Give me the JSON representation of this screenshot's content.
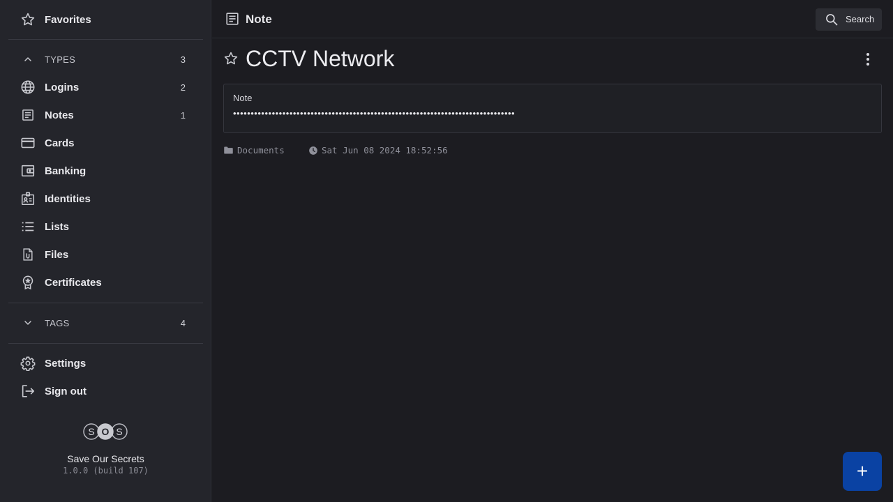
{
  "sidebar": {
    "favorites_label": "Favorites",
    "types": {
      "label": "TYPES",
      "count": "3"
    },
    "items": [
      {
        "label": "Logins",
        "count": "2",
        "icon": "globe-icon"
      },
      {
        "label": "Notes",
        "count": "1",
        "icon": "note-icon"
      },
      {
        "label": "Cards",
        "count": "",
        "icon": "card-icon"
      },
      {
        "label": "Banking",
        "count": "",
        "icon": "wallet-icon"
      },
      {
        "label": "Identities",
        "count": "",
        "icon": "id-badge-icon"
      },
      {
        "label": "Lists",
        "count": "",
        "icon": "list-icon"
      },
      {
        "label": "Files",
        "count": "",
        "icon": "file-clip-icon"
      },
      {
        "label": "Certificates",
        "count": "",
        "icon": "award-icon"
      }
    ],
    "tags": {
      "label": "TAGS",
      "count": "4"
    },
    "settings_label": "Settings",
    "signout_label": "Sign out",
    "logo_letters": [
      "S",
      "O",
      "S"
    ],
    "app_name": "Save Our Secrets",
    "app_version": "1.0.0 (build 107)"
  },
  "header": {
    "title": "Note",
    "search_label": "Search"
  },
  "item": {
    "title": "CCTV Network",
    "note_label": "Note",
    "note_value": "••••••••••••••••••••••••••••••••••••••••••••••••••••••••••••••••••••••••••••••••",
    "folder": "Documents",
    "timestamp": "Sat Jun 08 2024 18:52:56"
  },
  "fab_label": "+",
  "colors": {
    "sidebar_bg": "#24252b",
    "main_bg": "#1c1c21",
    "accent": "#0a42a3"
  }
}
